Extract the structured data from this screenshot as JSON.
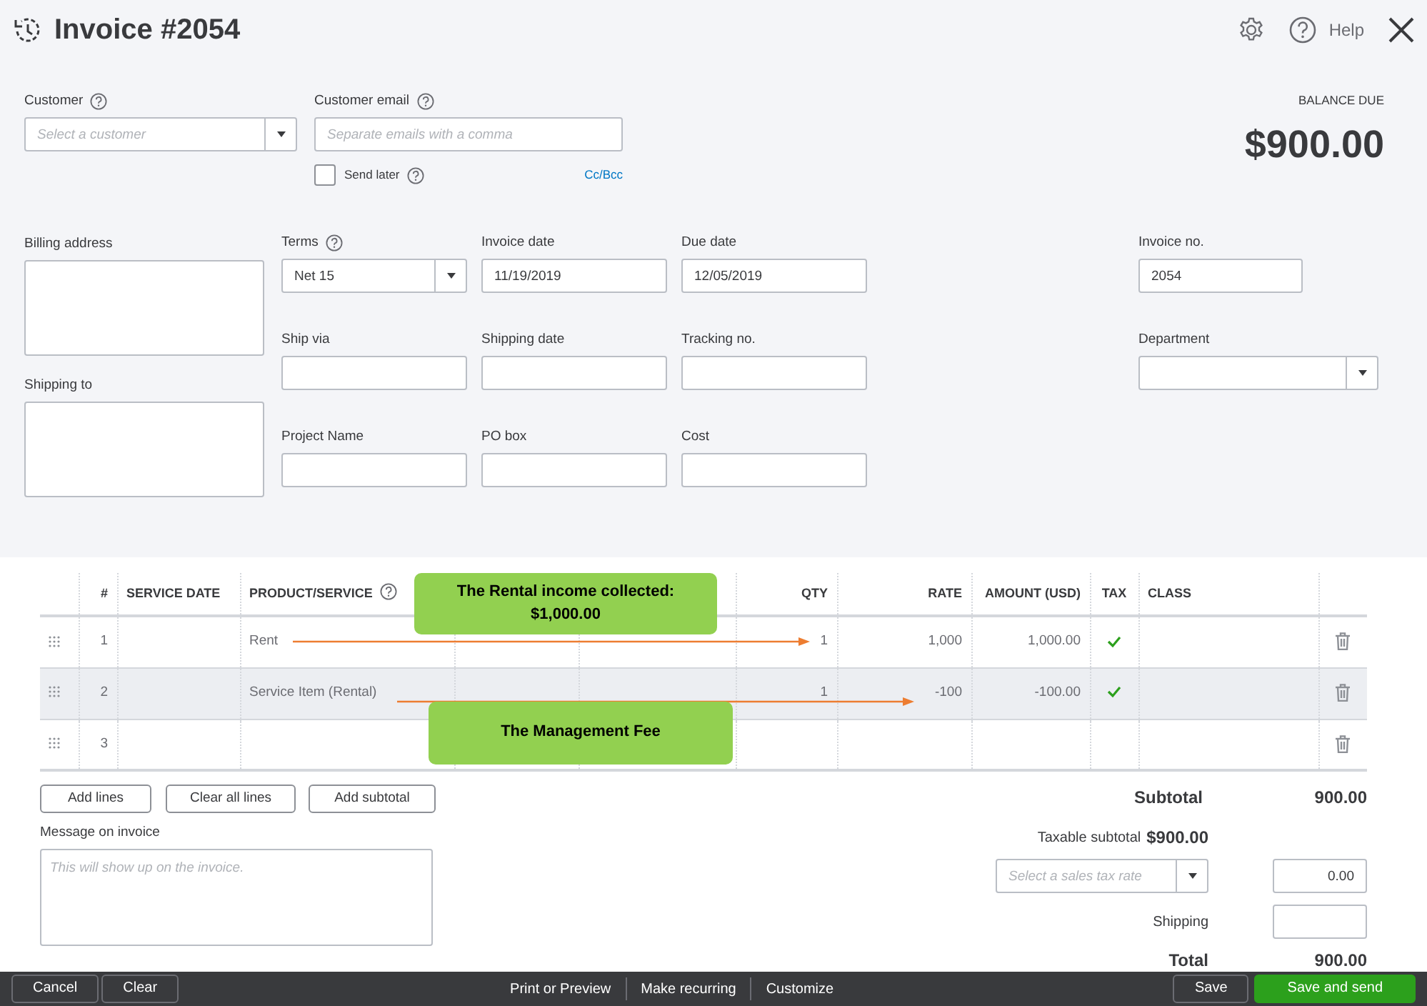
{
  "header": {
    "title": "Invoice #2054",
    "help": "Help"
  },
  "customer": {
    "label": "Customer",
    "help": true,
    "placeholder": "Select a customer"
  },
  "customer_email": {
    "label": "Customer email",
    "help": true,
    "placeholder": "Separate emails with a comma"
  },
  "send_later": {
    "label": "Send later",
    "checked": false,
    "help": true
  },
  "cc_bcc": "Cc/Bcc",
  "balance_due": {
    "label": "BALANCE DUE",
    "amount": "$900.00"
  },
  "address_fields": [
    {
      "label": "Billing address"
    },
    {
      "label": "Shipping to"
    }
  ],
  "detail_rows": [
    [
      {
        "label": "Terms",
        "kind": "select",
        "value": "Net 15",
        "help": true
      },
      {
        "label": "Invoice date",
        "kind": "text",
        "value": "11/19/2019"
      },
      {
        "label": "Due date",
        "kind": "text",
        "value": "12/05/2019"
      }
    ],
    [
      {
        "label": "Ship via",
        "kind": "text"
      },
      {
        "label": "Shipping date",
        "kind": "text"
      },
      {
        "label": "Tracking no.",
        "kind": "text"
      }
    ],
    [
      {
        "label": "Project Name",
        "kind": "text"
      },
      {
        "label": "PO box",
        "kind": "text"
      },
      {
        "label": "Cost",
        "kind": "text"
      }
    ]
  ],
  "right_fields": [
    {
      "label": "Invoice no.",
      "kind": "text",
      "value": "2054"
    },
    {
      "label": "Department",
      "kind": "select"
    }
  ],
  "table": {
    "columns": [
      {
        "label": "#"
      },
      {
        "label": "SERVICE DATE"
      },
      {
        "label": "PRODUCT/SERVICE",
        "help": true
      },
      {
        "label": "QTY"
      },
      {
        "label": "RATE"
      },
      {
        "label": "AMOUNT (USD)"
      },
      {
        "label": "TAX"
      },
      {
        "label": "CLASS"
      }
    ],
    "rows": [
      {
        "number": "1",
        "product": "Rent",
        "qty": "1",
        "rate": "1,000",
        "amount": "1,000.00",
        "tax": true,
        "selected": false
      },
      {
        "number": "2",
        "product": "Service Item (Rental)",
        "qty": "1",
        "rate": "-100",
        "amount": "-100.00",
        "tax": true,
        "selected": true
      },
      {
        "number": "3",
        "tax": false,
        "selected": false
      }
    ]
  },
  "annotations": [
    {
      "text": "The Rental income collected: $1,000.00"
    },
    {
      "text": "The Management Fee"
    }
  ],
  "table_buttons": [
    "Add lines",
    "Clear all lines",
    "Add subtotal"
  ],
  "message": {
    "label": "Message on invoice",
    "placeholder": "This will show up on the invoice."
  },
  "totals": {
    "subtotal": {
      "label": "Subtotal",
      "value": "900.00"
    },
    "taxable_subtotal": {
      "label": "Taxable subtotal",
      "value": "$900.00"
    },
    "tax_rate": {
      "placeholder": "Select a sales tax rate",
      "value": "0.00"
    },
    "shipping": {
      "label": "Shipping"
    },
    "total": {
      "label": "Total",
      "value": "900.00"
    }
  },
  "footer": {
    "left": [
      "Cancel",
      "Clear"
    ],
    "middle": [
      "Print or Preview",
      "Make recurring",
      "Customize"
    ],
    "right": [
      {
        "label": "Save",
        "kind": "secondary"
      },
      {
        "label": "Save and send",
        "kind": "primary"
      }
    ]
  }
}
